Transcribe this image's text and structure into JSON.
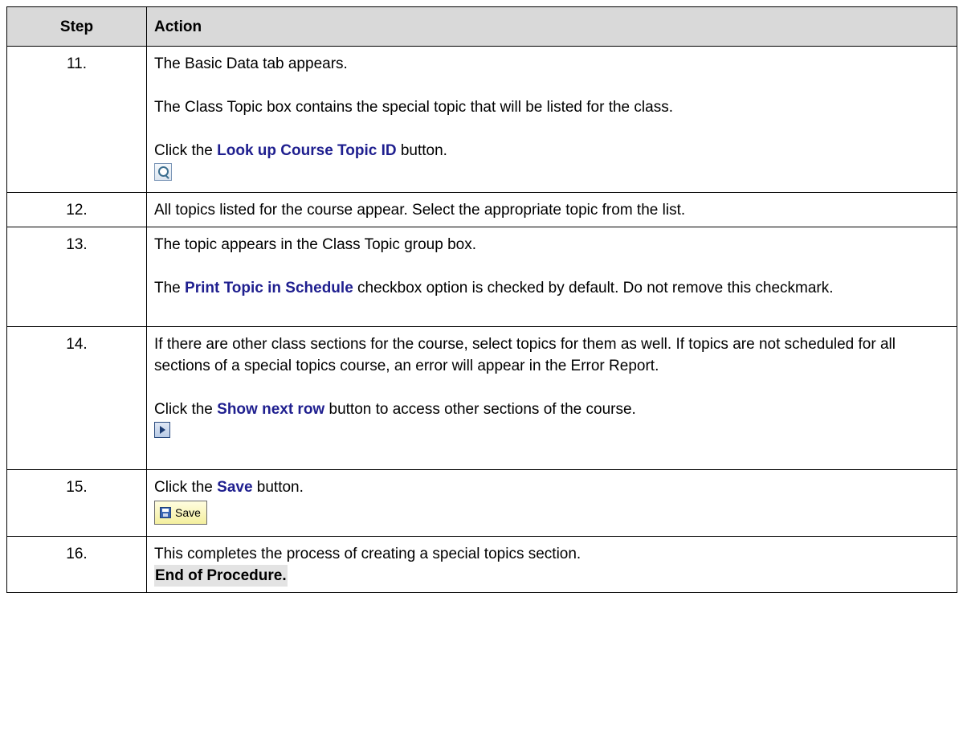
{
  "header": {
    "step": "Step",
    "action": "Action"
  },
  "rows": [
    {
      "step": "11.",
      "line1": "The Basic Data tab appears.",
      "line2": "The Class Topic box contains the special topic that will be listed for the class.",
      "click_prefix": "Click the ",
      "click_kw": "Look up Course Topic ID",
      "click_suffix": " button.",
      "icon": "lookup-magnifier-icon"
    },
    {
      "step": "12.",
      "line1": "All topics listed for the course appear.  Select the appropriate topic from the list."
    },
    {
      "step": "13.",
      "line1": "The topic appears in the Class Topic group box.",
      "line2_prefix": "The ",
      "line2_kw": "Print Topic in Schedule",
      "line2_suffix": " checkbox option is checked by default.  Do not remove this checkmark."
    },
    {
      "step": "14.",
      "line1": "If there are other class sections for the course, select topics for them as well.  If topics are not scheduled for all sections of a special topics course, an error will appear in the Error Report.",
      "click_prefix": "Click the ",
      "click_kw": "Show next row",
      "click_suffix": " button to access other sections of the course.",
      "icon": "show-next-row-arrow-icon"
    },
    {
      "step": "15.",
      "click_prefix": "Click the ",
      "click_kw": "Save",
      "click_suffix": " button.",
      "button_label": "Save",
      "icon": "floppy-disk-icon"
    },
    {
      "step": "16.",
      "line1": "This completes the process of creating a special topics section.",
      "end_text": "End of Procedure."
    }
  ],
  "colors": {
    "keyword": "#1f1f8f",
    "header_bg": "#d9d9d9"
  }
}
